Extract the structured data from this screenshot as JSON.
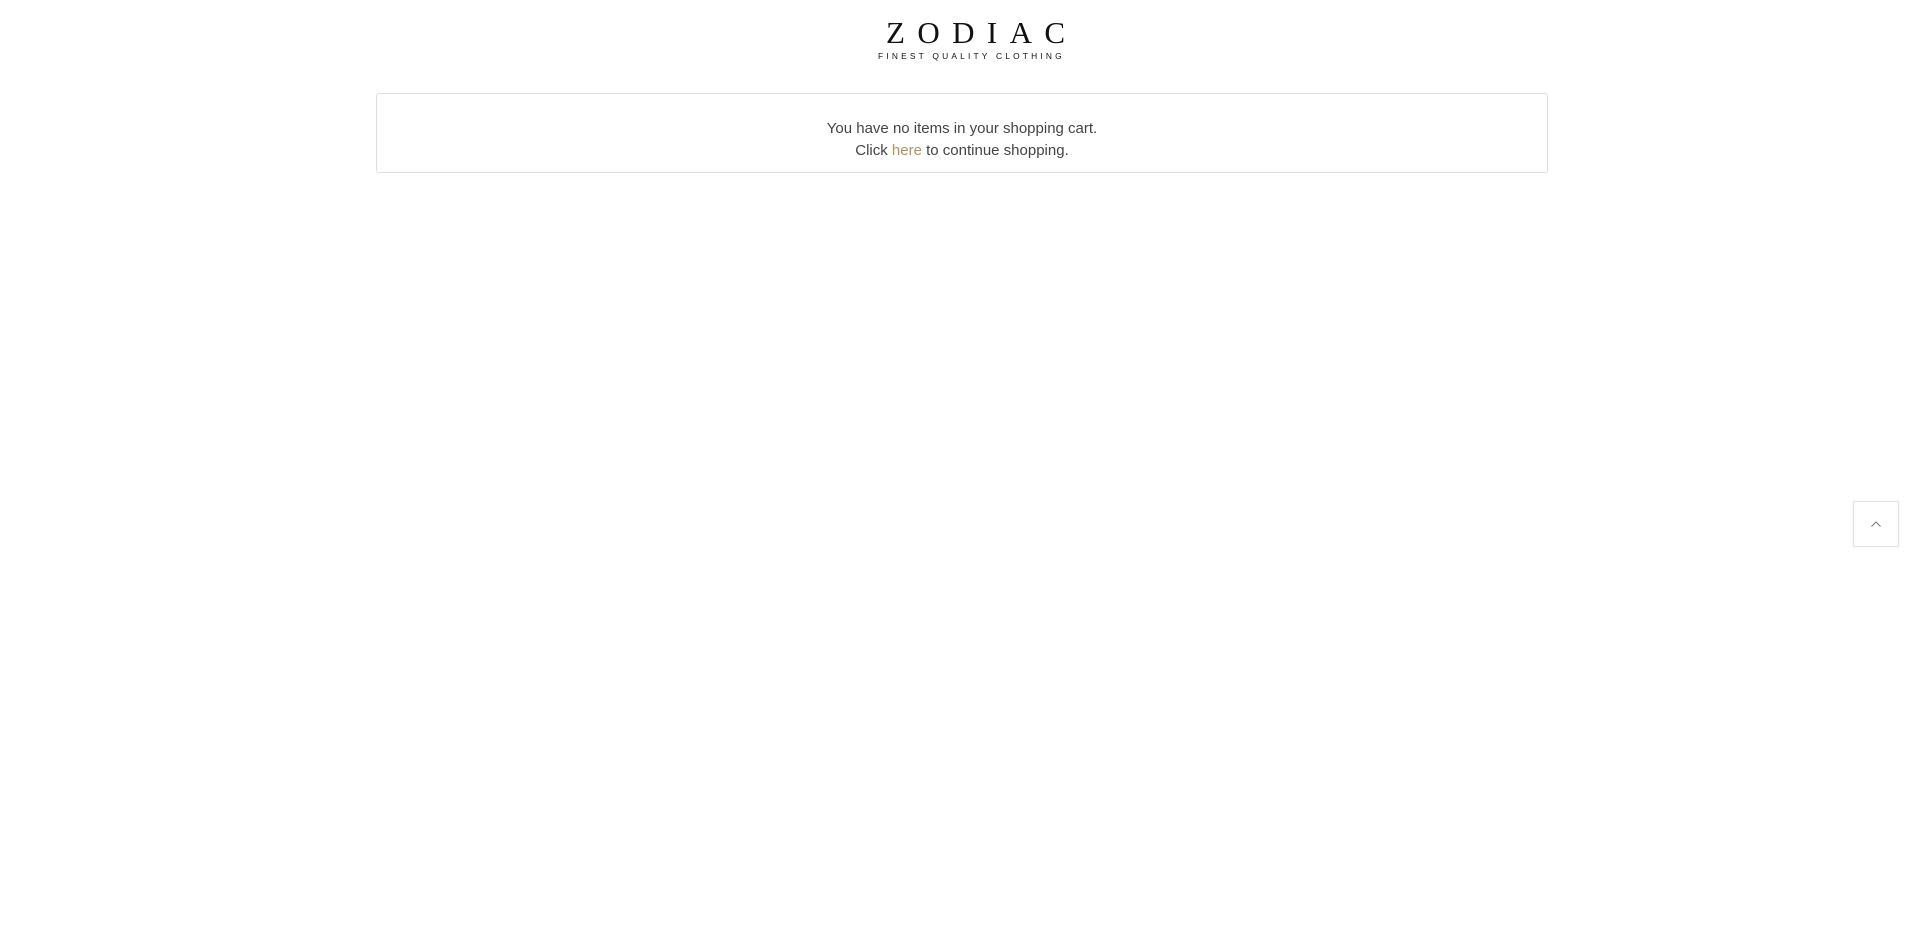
{
  "header": {
    "logo": {
      "wordmark": "ZODIAC",
      "tagline": "FINEST QUALITY CLOTHING"
    }
  },
  "cart": {
    "empty_message": "You have no items in your shopping cart.",
    "continue_prefix": "Click ",
    "continue_link": "here",
    "continue_suffix": " to continue shopping."
  },
  "back_to_top": {
    "icon": "chevron-up-icon"
  },
  "colors": {
    "link": "#b0926a",
    "text": "#444444",
    "border": "#dedede"
  }
}
